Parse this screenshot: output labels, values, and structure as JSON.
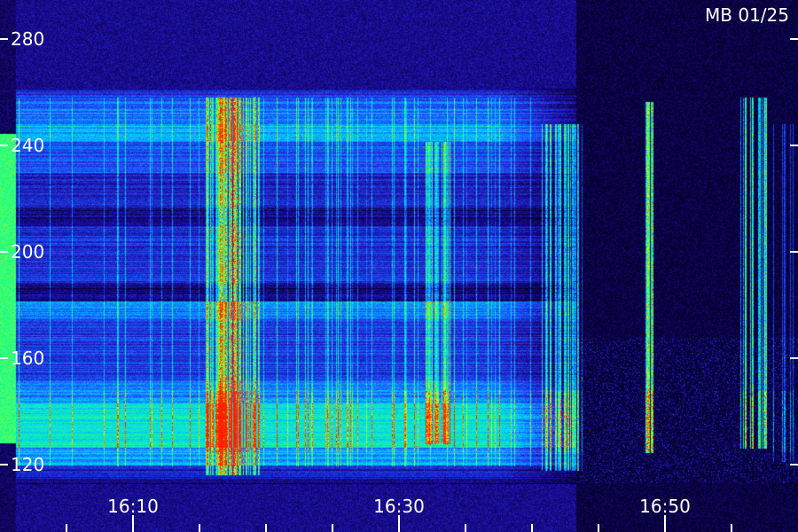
{
  "chart_data": {
    "type": "heatmap",
    "title": "MB 01/25",
    "xlabel": "",
    "ylabel": "",
    "x_ticks": [
      "16:10",
      "16:30",
      "16:50"
    ],
    "y_ticks": [
      "280",
      "240",
      "200",
      "160",
      "120"
    ],
    "y_tick_values": [
      280,
      240,
      200,
      160,
      120
    ],
    "ylim": [
      115,
      290
    ],
    "x_tick_minutes": [
      10,
      30,
      50
    ],
    "xlim_minutes": [
      0,
      60
    ],
    "minor_tick_minutes": [
      5,
      15,
      20,
      25,
      35,
      40,
      45,
      55
    ],
    "colormap": [
      "#000018",
      "#1c0a9a",
      "#1e50ff",
      "#00d0ff",
      "#20ff80",
      "#d0ff00",
      "#ff2000"
    ]
  }
}
